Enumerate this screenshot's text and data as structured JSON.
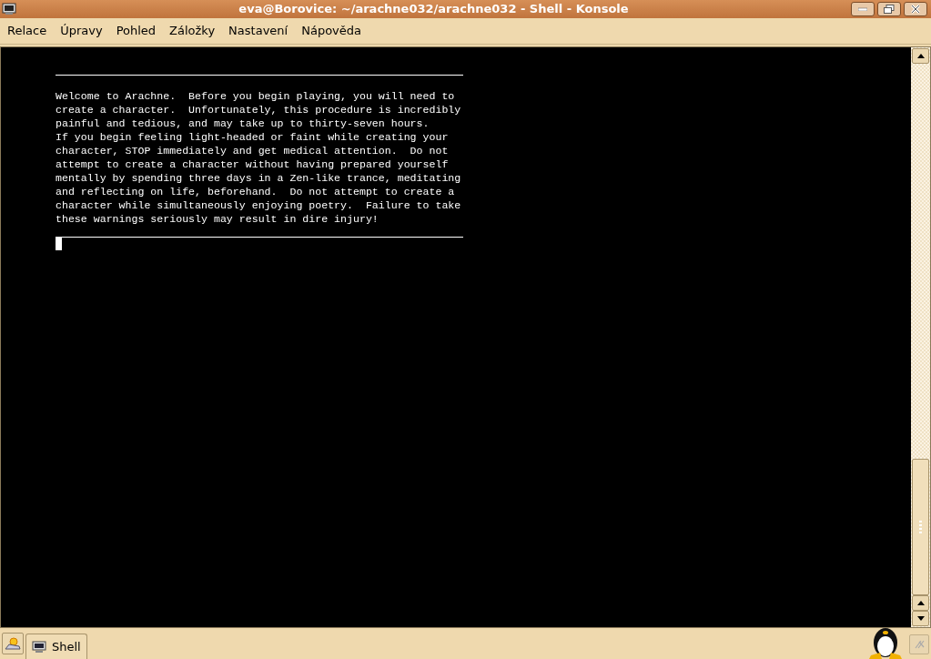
{
  "window": {
    "title": "eva@Borovice: ~/arachne032/arachne032 - Shell - Konsole"
  },
  "menu": [
    "Relace",
    "Úpravy",
    "Pohled",
    "Záložky",
    "Nastavení",
    "Nápověda"
  ],
  "terminal": {
    "lines": [
      "Welcome to Arachne.  Before you begin playing, you will need to",
      "create a character.  Unfortunately, this procedure is incredibly",
      "painful and tedious, and may take up to thirty-seven hours.",
      "If you begin feeling light-headed or faint while creating your",
      "character, STOP immediately and get medical attention.  Do not",
      "attempt to create a character without having prepared yourself",
      "mentally by spending three days in a Zen-like trance, meditating",
      "and reflecting on life, beforehand.  Do not attempt to create a",
      "character while simultaneously enjoying poetry.  Failure to take",
      "these warnings seriously may result in dire injury!"
    ]
  },
  "tabs": [
    {
      "label": "Shell",
      "selected": true
    }
  ]
}
